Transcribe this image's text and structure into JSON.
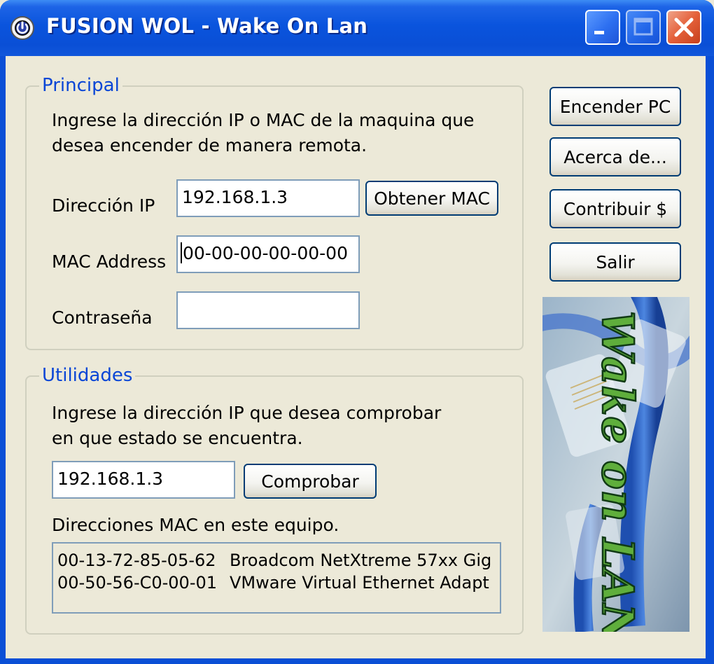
{
  "window": {
    "title": "FUSION WOL - Wake On Lan"
  },
  "principal": {
    "group_label": "Principal",
    "instruction_line1": "Ingrese la dirección IP o MAC de la maquina que",
    "instruction_line2": "desea encender de manera remota.",
    "ip_label": "Dirección IP",
    "ip_value": "192.168.1.3",
    "get_mac_label": "Obtener MAC",
    "mac_label": "MAC Address",
    "mac_value": "00-00-00-00-00-00",
    "password_label": "Contraseña",
    "password_value": ""
  },
  "utilidades": {
    "group_label": "Utilidades",
    "instruction_line1": "Ingrese la dirección IP que desea comprobar",
    "instruction_line2": "en que estado se encuentra.",
    "ip_value": "192.168.1.3",
    "check_label": "Comprobar",
    "mac_list_label": "Direcciones MAC en este equipo.",
    "mac_list": [
      {
        "mac": "00-13-72-85-05-62",
        "adapter": "Broadcom NetXtreme 57xx Gig"
      },
      {
        "mac": "00-50-56-C0-00-01",
        "adapter": "VMware Virtual Ethernet Adapt"
      }
    ]
  },
  "actions": {
    "power_on_label": "Encender PC",
    "about_label": "Acerca de...",
    "contribute_label": "Contribuir $",
    "exit_label": "Salir"
  },
  "banner": {
    "text": "Wake on LAN"
  },
  "colors": {
    "titlebar": "#0a4fd6",
    "client_bg": "#ece9d8",
    "group_label": "#0a46d6",
    "close_button": "#e4603a"
  },
  "icons": {
    "app": "power-icon",
    "minimize": "minimize-icon",
    "maximize": "maximize-icon",
    "close": "close-icon"
  }
}
